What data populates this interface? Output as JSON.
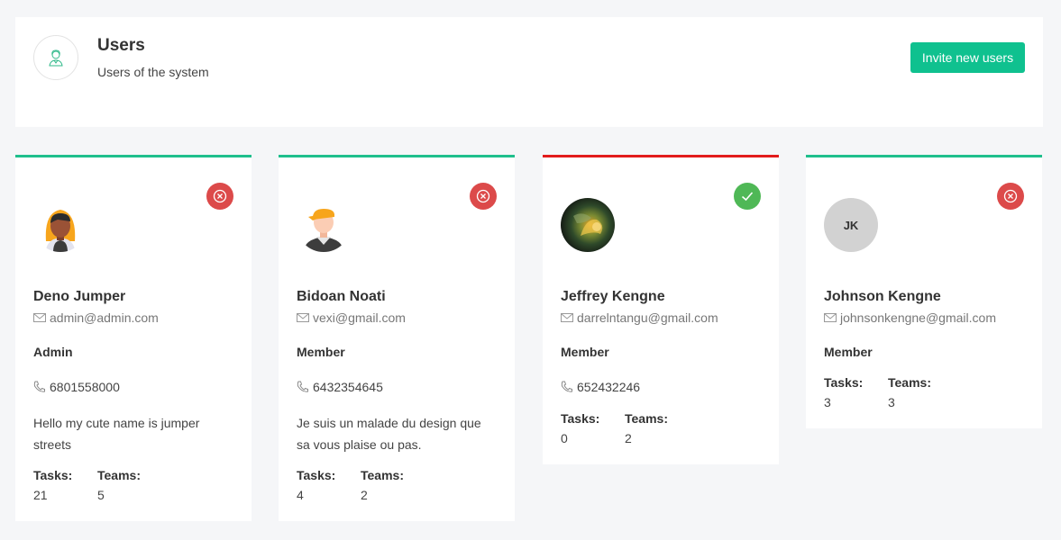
{
  "header": {
    "title": "Users",
    "subtitle": "Users of the system",
    "invite_label": "Invite new users",
    "icon": "user-avatar-icon"
  },
  "colors": {
    "accent": "#0fc18f",
    "active_border": "#1fbf8c",
    "inactive_border": "#e21c1c",
    "status_red": "#dc4a4a",
    "status_green": "#4fb856"
  },
  "stats_labels": {
    "tasks": "Tasks:",
    "teams": "Teams:"
  },
  "users": [
    {
      "name": "Deno Jumper",
      "email": "admin@admin.com",
      "role": "Admin",
      "phone": "6801558000",
      "bio": "Hello my cute name is jumper streets",
      "tasks": "21",
      "teams": "5",
      "status": "inactive",
      "status_icon": "close-circle-icon",
      "avatar": "female-avatar-icon"
    },
    {
      "name": "Bidoan Noati",
      "email": "vexi@gmail.com",
      "role": "Member",
      "phone": "6432354645",
      "bio": "Je suis un malade du design que sa vous plaise ou pas.",
      "tasks": "4",
      "teams": "2",
      "status": "inactive",
      "status_icon": "close-circle-icon",
      "avatar": "male-avatar-icon"
    },
    {
      "name": "Jeffrey Kengne",
      "email": "darrelntangu@gmail.com",
      "role": "Member",
      "phone": "652432246",
      "bio": "",
      "tasks": "0",
      "teams": "2",
      "status": "active",
      "status_icon": "check-icon",
      "avatar": "photo-avatar"
    },
    {
      "name": "Johnson Kengne",
      "email": "johnsonkengne@gmail.com",
      "role": "Member",
      "phone": "",
      "bio": "",
      "tasks": "3",
      "teams": "3",
      "status": "inactive",
      "status_icon": "close-circle-icon",
      "avatar_initials": "JK"
    }
  ]
}
